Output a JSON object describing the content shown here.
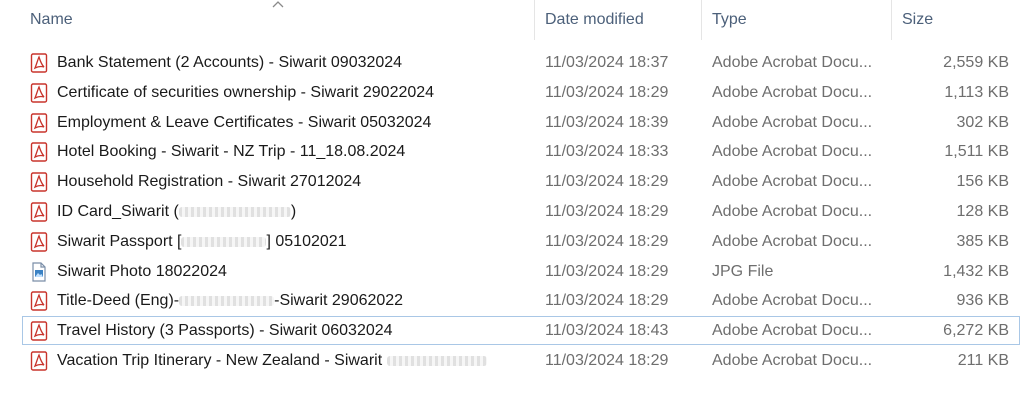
{
  "columns": {
    "name": "Name",
    "date": "Date modified",
    "type": "Type",
    "size": "Size"
  },
  "sort": {
    "column": "name",
    "direction": "ascending",
    "icon": "chevron-up-icon"
  },
  "files": [
    {
      "name": "Bank Statement (2 Accounts) - Siwarit 09032024",
      "date": "11/03/2024 18:37",
      "type": "Adobe Acrobat Docu...",
      "size": "2,559 KB",
      "icon": "pdf-icon"
    },
    {
      "name": "Certificate of securities ownership - Siwarit 29022024",
      "date": "11/03/2024 18:29",
      "type": "Adobe Acrobat Docu...",
      "size": "1,113 KB",
      "icon": "pdf-icon"
    },
    {
      "name": "Employment & Leave Certificates - Siwarit 05032024",
      "date": "11/03/2024 18:39",
      "type": "Adobe Acrobat Docu...",
      "size": "302 KB",
      "icon": "pdf-icon"
    },
    {
      "name": "Hotel Booking - Siwarit - NZ Trip - 11_18.08.2024",
      "date": "11/03/2024 18:33",
      "type": "Adobe Acrobat Docu...",
      "size": "1,511 KB",
      "icon": "pdf-icon"
    },
    {
      "name": "Household Registration - Siwarit 27012024",
      "date": "11/03/2024 18:29",
      "type": "Adobe Acrobat Docu...",
      "size": "156 KB",
      "icon": "pdf-icon"
    },
    {
      "name": "ID Card_Siwarit (",
      "name_suffix": ")",
      "date": "11/03/2024 18:29",
      "type": "Adobe Acrobat Docu...",
      "size": "128 KB",
      "icon": "pdf-icon"
    },
    {
      "name": "Siwarit Passport [",
      "name_suffix": "] 05102021",
      "date": "11/03/2024 18:29",
      "type": "Adobe Acrobat Docu...",
      "size": "385 KB",
      "icon": "pdf-icon"
    },
    {
      "name": "Siwarit Photo 18022024",
      "date": "11/03/2024 18:29",
      "type": "JPG File",
      "size": "1,432 KB",
      "icon": "jpg-image-icon"
    },
    {
      "name": "Title-Deed (Eng)-",
      "name_suffix": "-Siwarit 29062022",
      "date": "11/03/2024 18:29",
      "type": "Adobe Acrobat Docu...",
      "size": "936 KB",
      "icon": "pdf-icon"
    },
    {
      "name": "Travel History  (3 Passports) - Siwarit 06032024",
      "date": "11/03/2024 18:43",
      "type": "Adobe Acrobat Docu...",
      "size": "6,272 KB",
      "icon": "pdf-icon",
      "focused": true
    },
    {
      "name": "Vacation Trip Itinerary - New Zealand - Siwarit ",
      "date": "11/03/2024 18:29",
      "type": "Adobe Acrobat Docu...",
      "size": "211 KB",
      "icon": "pdf-icon"
    }
  ]
}
